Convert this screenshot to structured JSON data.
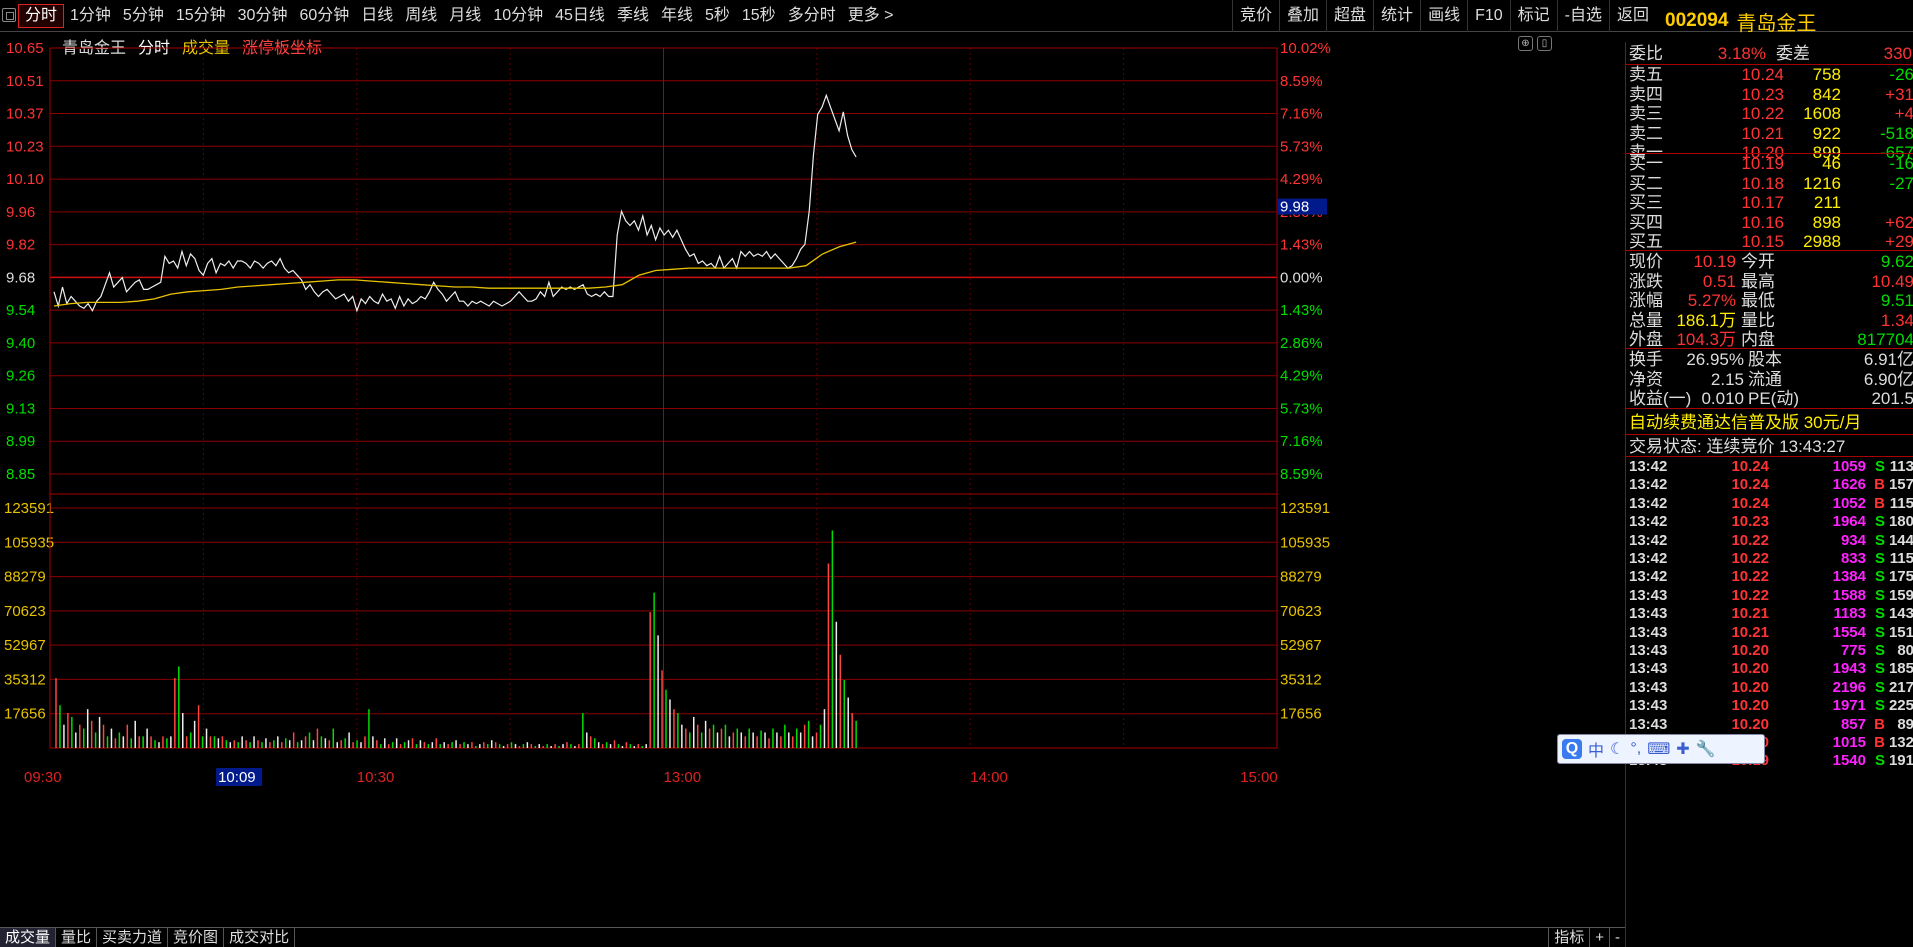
{
  "toolbar": {
    "periods": [
      "分时",
      "1分钟",
      "5分钟",
      "15分钟",
      "30分钟",
      "60分钟",
      "日线",
      "周线",
      "月线",
      "10分钟",
      "45日线",
      "季线",
      "年线",
      "5秒",
      "15秒",
      "多分时",
      "更多 >"
    ],
    "active": "分时",
    "right_tools": [
      "竞价",
      "叠加",
      "超盘",
      "统计",
      "画线",
      "F10",
      "标记",
      "-自选",
      "返回"
    ]
  },
  "stock": {
    "code": "002094",
    "name": "青岛金王"
  },
  "legend": {
    "name": "青岛金王",
    "mode": "分时",
    "vol": "成交量",
    "coord": "涨停板坐标"
  },
  "chart_data": {
    "type": "line",
    "prev_close": 9.68,
    "price_axis": [
      "10.65",
      "10.51",
      "10.37",
      "10.23",
      "10.10",
      "9.96",
      "9.82",
      "9.68",
      "9.54",
      "9.40",
      "9.26",
      "9.13",
      "8.99",
      "8.85"
    ],
    "pct_axis": [
      "10.02%",
      "8.59%",
      "7.16%",
      "5.73%",
      "4.29%",
      "2.86%",
      "1.43%",
      "0.00%",
      "1.43%",
      "2.86%",
      "4.29%",
      "5.73%",
      "7.16%",
      "8.59%"
    ],
    "vol_axis": [
      "123591",
      "105935",
      "88279",
      "70623",
      "52967",
      "35312",
      "17656"
    ],
    "time_labels": [
      "09:30",
      "10:09",
      "10:30",
      "13:00",
      "14:00",
      "15:00"
    ],
    "cursor_price": "9.98",
    "price_series": [
      9.62,
      9.56,
      9.64,
      9.57,
      9.6,
      9.58,
      9.56,
      9.55,
      9.57,
      9.54,
      9.58,
      9.6,
      9.65,
      9.7,
      9.64,
      9.66,
      9.68,
      9.62,
      9.64,
      9.66,
      9.67,
      9.63,
      9.63,
      9.64,
      9.65,
      9.66,
      9.77,
      9.74,
      9.75,
      9.72,
      9.79,
      9.73,
      9.78,
      9.76,
      9.71,
      9.69,
      9.74,
      9.76,
      9.7,
      9.74,
      9.73,
      9.75,
      9.72,
      9.75,
      9.75,
      9.74,
      9.72,
      9.75,
      9.74,
      9.72,
      9.74,
      9.75,
      9.73,
      9.76,
      9.72,
      9.7,
      9.71,
      9.69,
      9.67,
      9.63,
      9.65,
      9.62,
      9.6,
      9.62,
      9.63,
      9.61,
      9.59,
      9.6,
      9.61,
      9.58,
      9.6,
      9.54,
      9.59,
      9.57,
      9.6,
      9.58,
      9.57,
      9.61,
      9.58,
      9.59,
      9.55,
      9.6,
      9.56,
      9.59,
      9.57,
      9.58,
      9.6,
      9.59,
      9.62,
      9.66,
      9.63,
      9.61,
      9.58,
      9.6,
      9.62,
      9.58,
      9.58,
      9.56,
      9.58,
      9.57,
      9.58,
      9.57,
      9.56,
      9.58,
      9.57,
      9.56,
      9.57,
      9.58,
      9.6,
      9.62,
      9.6,
      9.58,
      9.58,
      9.59,
      9.62,
      9.6,
      9.66,
      9.6,
      9.62,
      9.64,
      9.63,
      9.64,
      9.63,
      9.64,
      9.65,
      9.61,
      9.6,
      9.61,
      9.6,
      9.62,
      9.6,
      9.6,
      9.86,
      9.96,
      9.92,
      9.9,
      9.92,
      9.88,
      9.94,
      9.86,
      9.9,
      9.84,
      9.89,
      9.86,
      9.88,
      9.85,
      9.88,
      9.84,
      9.8,
      9.77,
      9.78,
      9.74,
      9.75,
      9.73,
      9.74,
      9.72,
      9.77,
      9.72,
      9.74,
      9.76,
      9.72,
      9.79,
      9.77,
      9.79,
      9.77,
      9.78,
      9.77,
      9.79,
      9.76,
      9.78,
      9.76,
      9.74,
      9.72,
      9.73,
      9.76,
      9.8,
      9.82,
      9.96,
      10.2,
      10.37,
      10.4,
      10.45,
      10.4,
      10.35,
      10.3,
      10.38,
      10.28,
      10.22,
      10.19
    ],
    "avg_series": [
      9.56,
      9.57,
      9.575,
      9.575,
      9.575,
      9.58,
      9.59,
      9.61,
      9.62,
      9.625,
      9.63,
      9.64,
      9.645,
      9.65,
      9.655,
      9.66,
      9.665,
      9.67,
      9.67,
      9.665,
      9.66,
      9.655,
      9.65,
      9.645,
      9.64,
      9.64,
      9.635,
      9.635,
      9.635,
      9.635,
      9.635,
      9.635,
      9.635,
      9.64,
      9.65,
      9.69,
      9.71,
      9.715,
      9.72,
      9.72,
      9.72,
      9.72,
      9.72,
      9.72,
      9.72,
      9.73,
      9.78,
      9.81,
      9.83
    ],
    "volumes": [
      36000,
      22000,
      12000,
      18000,
      16000,
      8000,
      12000,
      10000,
      20000,
      14000,
      8000,
      16000,
      12000,
      6000,
      10000,
      5000,
      8000,
      6000,
      12000,
      5000,
      14000,
      6000,
      6000,
      10000,
      6000,
      4000,
      3000,
      6000,
      5000,
      6000,
      36000,
      42000,
      18000,
      6000,
      8000,
      14000,
      22000,
      6000,
      10000,
      6000,
      6000,
      5000,
      6000,
      4000,
      3000,
      4000,
      3000,
      6000,
      4000,
      3000,
      6000,
      4000,
      3000,
      5000,
      3000,
      4000,
      6000,
      3000,
      5000,
      4000,
      8000,
      3000,
      4000,
      6000,
      8000,
      4000,
      10000,
      6000,
      5000,
      4000,
      10000,
      3000,
      4000,
      5000,
      8000,
      3000,
      4000,
      3000,
      6000,
      20000,
      6000,
      4000,
      2000,
      5000,
      2000,
      3000,
      5000,
      2000,
      3000,
      4000,
      5000,
      2000,
      4000,
      3000,
      2000,
      3000,
      5000,
      2000,
      3000,
      2000,
      3000,
      4000,
      2000,
      3000,
      2000,
      3000,
      1000,
      2000,
      3000,
      2000,
      4000,
      3000,
      2000,
      1000,
      2000,
      3000,
      2000,
      1000,
      2000,
      3000,
      2000,
      1000,
      2000,
      1000,
      2000,
      1000,
      2000,
      1000,
      2000,
      3000,
      2000,
      1000,
      2000,
      18000,
      8000,
      6000,
      5000,
      3000,
      2000,
      3000,
      2000,
      4000,
      2000,
      1000,
      3000,
      2000,
      1000,
      2000,
      1000,
      2000,
      70000,
      80000,
      58000,
      40000,
      30000,
      25000,
      20000,
      18000,
      12000,
      10000,
      8000,
      16000,
      12000,
      8000,
      14000,
      10000,
      12000,
      8000,
      10000,
      12000,
      6000,
      8000,
      10000,
      8000,
      6000,
      10000,
      8000,
      6000,
      9000,
      8000,
      5000,
      10000,
      8000,
      6000,
      12000,
      8000,
      6000,
      10000,
      8000,
      12000,
      14000,
      6000,
      8000,
      12000,
      20000,
      95000,
      112000,
      65000,
      48000,
      35000,
      26000,
      18000,
      14000
    ],
    "vol_colors": "rg"
  },
  "quote": {
    "weibi_label": "委比",
    "weibi": "3.18%",
    "weicha_label": "委差",
    "weicha": "330",
    "sell": [
      {
        "label": "卖五",
        "price": "10.24",
        "vol": "758",
        "chg": "-26"
      },
      {
        "label": "卖四",
        "price": "10.23",
        "vol": "842",
        "chg": "+31"
      },
      {
        "label": "卖三",
        "price": "10.22",
        "vol": "1608",
        "chg": "+4"
      },
      {
        "label": "卖二",
        "price": "10.21",
        "vol": "922",
        "chg": "-518"
      },
      {
        "label": "卖一",
        "price": "10.20",
        "vol": "899",
        "chg": "-657"
      }
    ],
    "buy": [
      {
        "label": "买一",
        "price": "10.19",
        "vol": "46",
        "chg": "-16"
      },
      {
        "label": "买二",
        "price": "10.18",
        "vol": "1216",
        "chg": "-27"
      },
      {
        "label": "买三",
        "price": "10.17",
        "vol": "211",
        "chg": ""
      },
      {
        "label": "买四",
        "price": "10.16",
        "vol": "898",
        "chg": "+62"
      },
      {
        "label": "买五",
        "price": "10.15",
        "vol": "2988",
        "chg": "+29"
      }
    ],
    "stats": [
      {
        "l1": "现价",
        "v1": "10.19",
        "l2": "今开",
        "v2": "9.62",
        "c1": "c-red",
        "c2": "c-grn"
      },
      {
        "l1": "涨跌",
        "v1": "0.51",
        "l2": "最高",
        "v2": "10.49",
        "c1": "c-red",
        "c2": "c-red"
      },
      {
        "l1": "涨幅",
        "v1": "5.27%",
        "l2": "最低",
        "v2": "9.51",
        "c1": "c-red",
        "c2": "c-grn"
      },
      {
        "l1": "总量",
        "v1": "186.1万",
        "l2": "量比",
        "v2": "1.34",
        "c1": "c-yel",
        "c2": "c-red"
      },
      {
        "l1": "外盘",
        "v1": "104.3万",
        "l2": "内盘",
        "v2": "817704",
        "c1": "c-red",
        "c2": "c-grn"
      }
    ],
    "fin": [
      {
        "l1": "换手",
        "v1": "26.95%",
        "l2": "股本",
        "v2": "6.91亿"
      },
      {
        "l1": "净资",
        "v1": "2.15",
        "l2": "流通",
        "v2": "6.90亿"
      },
      {
        "l1": "收益(一)",
        "v1": "0.010",
        "l2": "PE(动)",
        "v2": "201.5"
      }
    ],
    "ad": "自动续费通达信普及版  30元/月",
    "status": "交易状态: 连续竞价 13:43:27"
  },
  "ticks": [
    {
      "t": "13:42",
      "p": "10.24",
      "v": "1059",
      "s": "S",
      "n": "113"
    },
    {
      "t": "13:42",
      "p": "10.24",
      "v": "1626",
      "s": "B",
      "n": "157"
    },
    {
      "t": "13:42",
      "p": "10.24",
      "v": "1052",
      "s": "B",
      "n": "115"
    },
    {
      "t": "13:42",
      "p": "10.23",
      "v": "1964",
      "s": "S",
      "n": "180"
    },
    {
      "t": "13:42",
      "p": "10.22",
      "v": "934",
      "s": "S",
      "n": "144"
    },
    {
      "t": "13:42",
      "p": "10.22",
      "v": "833",
      "s": "S",
      "n": "115"
    },
    {
      "t": "13:42",
      "p": "10.22",
      "v": "1384",
      "s": "S",
      "n": "175"
    },
    {
      "t": "13:43",
      "p": "10.22",
      "v": "1588",
      "s": "S",
      "n": "159"
    },
    {
      "t": "13:43",
      "p": "10.21",
      "v": "1183",
      "s": "S",
      "n": "143"
    },
    {
      "t": "13:43",
      "p": "10.21",
      "v": "1554",
      "s": "S",
      "n": "151"
    },
    {
      "t": "13:43",
      "p": "10.20",
      "v": "775",
      "s": "S",
      "n": "80"
    },
    {
      "t": "13:43",
      "p": "10.20",
      "v": "1943",
      "s": "S",
      "n": "185"
    },
    {
      "t": "13:43",
      "p": "10.20",
      "v": "2196",
      "s": "S",
      "n": "217"
    },
    {
      "t": "13:43",
      "p": "10.20",
      "v": "1971",
      "s": "S",
      "n": "225"
    },
    {
      "t": "13:43",
      "p": "10.20",
      "v": "857",
      "s": "B",
      "n": "89"
    },
    {
      "t": "13:43",
      "p": "10.20",
      "v": "1015",
      "s": "B",
      "n": "132"
    },
    {
      "t": "13:43",
      "p": "10.19",
      "v": "1540",
      "s": "S",
      "n": "191"
    }
  ],
  "bottom": {
    "tabs": [
      "成交量",
      "量比",
      "买卖力道",
      "竞价图",
      "成交对比"
    ],
    "right": [
      "指标",
      "+",
      "-"
    ]
  },
  "ime": {
    "q": "Q",
    "zh": "中"
  }
}
